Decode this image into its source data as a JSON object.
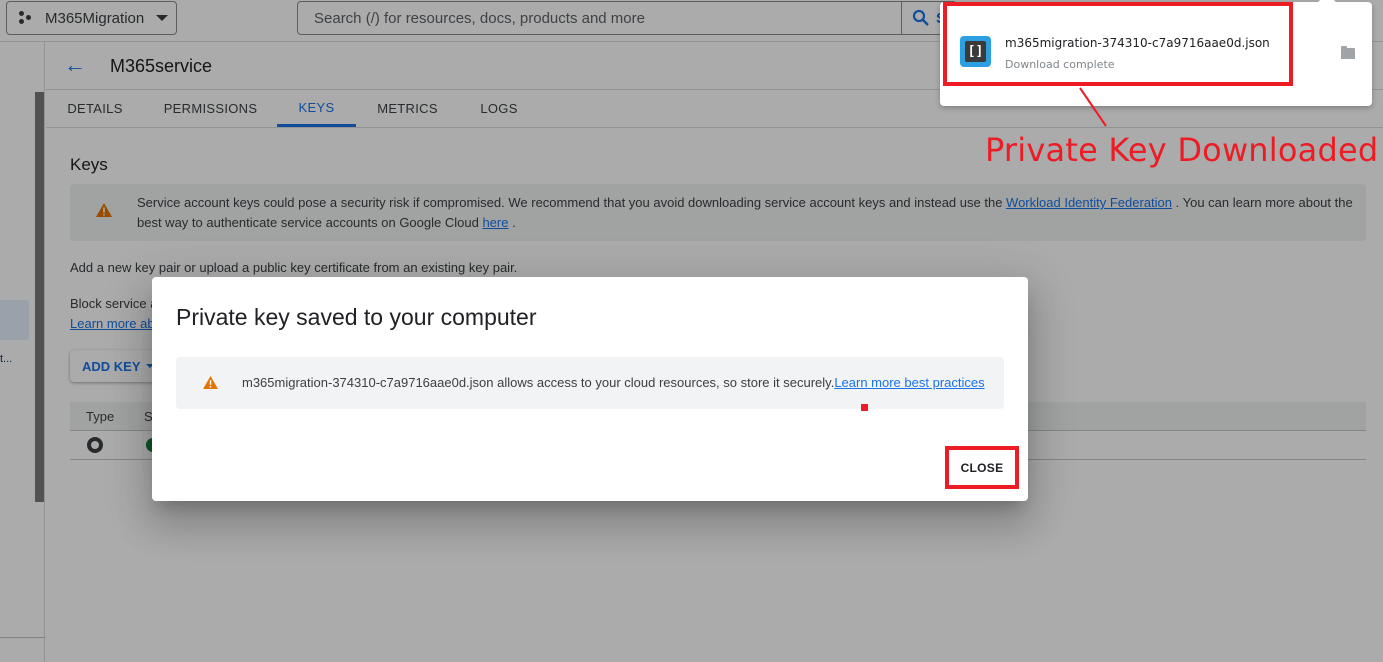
{
  "topbar": {
    "project_name": "M365Migration",
    "search_placeholder": "Search (/) for resources, docs, products and more",
    "search_button_label": "S"
  },
  "header": {
    "back_icon": "arrow-left-icon",
    "title": "M365service"
  },
  "tabs": [
    {
      "label": "DETAILS",
      "active": false
    },
    {
      "label": "PERMISSIONS",
      "active": false
    },
    {
      "label": "KEYS",
      "active": true
    },
    {
      "label": "METRICS",
      "active": false
    },
    {
      "label": "LOGS",
      "active": false
    }
  ],
  "keys_section": {
    "heading": "Keys",
    "warning": {
      "text_before": "Service account keys could pose a security risk if compromised. We recommend that you avoid downloading service account keys and instead use the ",
      "link1": "Workload Identity Federation",
      "text_middle": " . You can learn more about the best way to authenticate service accounts on Google Cloud ",
      "link2": "here",
      "text_after": " ."
    },
    "add_pair_text": "Add a new key pair or upload a public key certificate from an existing key pair.",
    "block_text": "Block service a",
    "learn_text": "Learn more ab",
    "add_key_label": "ADD KEY",
    "table": {
      "columns": [
        "Type",
        "S"
      ],
      "rows": [
        {
          "type_icon": "key-hex-icon",
          "status_icon": "check-circle-icon"
        }
      ]
    }
  },
  "leftnav": {
    "truncated_item": "t..."
  },
  "dialog": {
    "title": "Private key saved to your computer",
    "note_text": "m365migration-374310-c7a9716aae0d.json allows access to your cloud resources, so store it securely.",
    "note_link": "Learn more best practices",
    "close_label": "CLOSE"
  },
  "download": {
    "filename": "m365migration-374310-c7a9716aae0d.json",
    "status": "Download complete",
    "app_icon": "brackets-app-icon",
    "folder_icon": "folder-icon"
  },
  "annotation": {
    "text": "Private Key Downloaded",
    "color": "#ed1c24"
  },
  "colors": {
    "accent": "#1a73e8",
    "warning": "#e37400",
    "success": "#188038"
  }
}
